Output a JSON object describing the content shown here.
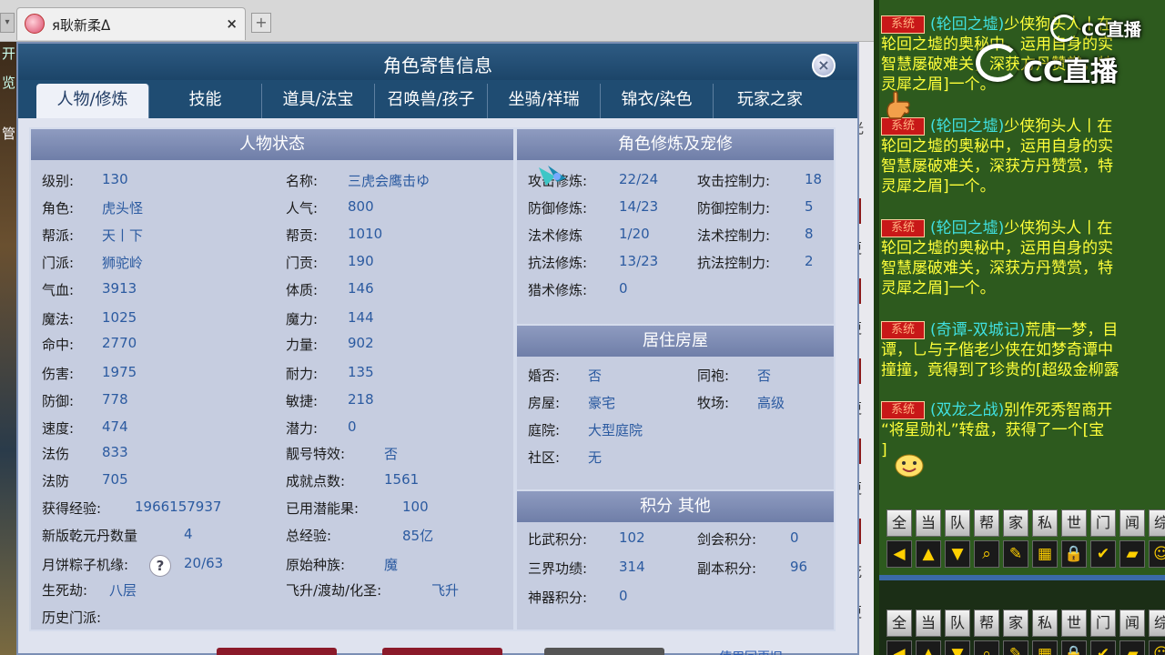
{
  "browser": {
    "tab_title": "я耿新柔ᐃ",
    "close": "×",
    "new_tab": "+",
    "arrow": "▾"
  },
  "dialog": {
    "title": "角色寄售信息",
    "close": "×",
    "tabs": [
      "人物/修炼",
      "技能",
      "道具/法宝",
      "召唤兽/孩子",
      "坐骑/祥瑞",
      "锦衣/染色",
      "玩家之家"
    ]
  },
  "character_status": {
    "header": "人物状态",
    "left": [
      {
        "label": "级别:",
        "value": "130"
      },
      {
        "label": "角色:",
        "value": "虎头怪"
      },
      {
        "label": "帮派:",
        "value": "天丨下"
      },
      {
        "label": "门派:",
        "value": "狮驼岭"
      },
      {
        "label": "气血:",
        "value": "3913"
      },
      {
        "label": "魔法:",
        "value": "1025"
      },
      {
        "label": "命中:",
        "value": "2770"
      },
      {
        "label": "伤害:",
        "value": "1975"
      },
      {
        "label": "防御:",
        "value": "778"
      },
      {
        "label": "速度:",
        "value": "474"
      },
      {
        "label": "法伤",
        "value": "833"
      },
      {
        "label": "法防",
        "value": "705"
      },
      {
        "label": "获得经验:",
        "value": "1966157937"
      },
      {
        "label": "新版乾元丹数量",
        "value": "4"
      },
      {
        "label": "月饼粽子机缘:",
        "value": "20/63"
      },
      {
        "label": "生死劫:",
        "value": "八层"
      },
      {
        "label": "历史门派:",
        "value": ""
      }
    ],
    "right": [
      {
        "label": "名称:",
        "value": "三虎会鹰击ゆ"
      },
      {
        "label": "人气:",
        "value": "800"
      },
      {
        "label": "帮贡:",
        "value": "1010"
      },
      {
        "label": "门贡:",
        "value": "190"
      },
      {
        "label": "体质:",
        "value": "146"
      },
      {
        "label": "魔力:",
        "value": "144"
      },
      {
        "label": "力量:",
        "value": "902"
      },
      {
        "label": "耐力:",
        "value": "135"
      },
      {
        "label": "敏捷:",
        "value": "218"
      },
      {
        "label": "潜力:",
        "value": "0"
      },
      {
        "label": "靓号特效:",
        "value": "否"
      },
      {
        "label": "成就点数:",
        "value": "1561"
      },
      {
        "label": "已用潜能果:",
        "value": "100"
      },
      {
        "label": "总经验:",
        "value": "85亿"
      },
      {
        "label": "原始种族:",
        "value": "魔"
      },
      {
        "label": "飞升/渡劫/化圣:",
        "value": "飞升"
      }
    ],
    "help": "?"
  },
  "cultivation": {
    "header": "角色修炼及宠修",
    "rows": [
      {
        "l1": "攻击修炼:",
        "v1": "22/24",
        "l2": "攻击控制力:",
        "v2": "18"
      },
      {
        "l1": "防御修炼:",
        "v1": "14/23",
        "l2": "防御控制力:",
        "v2": "5"
      },
      {
        "l1": "法术修炼",
        "v1": "1/20",
        "l2": "法术控制力:",
        "v2": "8"
      },
      {
        "l1": "抗法修炼:",
        "v1": "13/23",
        "l2": "抗法控制力:",
        "v2": "2"
      },
      {
        "l1": "猎术修炼:",
        "v1": "0",
        "l2": "",
        "v2": ""
      }
    ]
  },
  "housing": {
    "header": "居住房屋",
    "rows": [
      {
        "l1": "婚否:",
        "v1": "否",
        "l2": "同袍:",
        "v2": "否"
      },
      {
        "l1": "房屋:",
        "v1": "豪宅",
        "l2": "牧场:",
        "v2": "高级"
      },
      {
        "l1": "庭院:",
        "v1": "大型庭院",
        "l2": "",
        "v2": ""
      },
      {
        "l1": "社区:",
        "v1": "无",
        "l2": "",
        "v2": ""
      }
    ]
  },
  "points": {
    "header": "积分 其他",
    "rows": [
      {
        "l1": "比武积分:",
        "v1": "102",
        "l2": "剑会积分:",
        "v2": "0"
      },
      {
        "l1": "三界功绩:",
        "v1": "314",
        "l2": "副本积分:",
        "v2": "96"
      },
      {
        "l1": "神器积分:",
        "v1": "0",
        "l2": "",
        "v2": ""
      }
    ]
  },
  "bottom": {
    "link": "使用回更旧"
  },
  "right_strip": {
    "items": [
      "开",
      "览",
      "管",
      "光"
    ],
    "red_items": [
      "则",
      "则",
      "则",
      "则",
      "则",
      "则"
    ],
    "gray_items": [
      "更",
      "更",
      "更",
      "更",
      "更",
      "更",
      "更",
      "死",
      "更"
    ]
  },
  "chat": {
    "messages": [
      {
        "tag": "系统",
        "chan": "(轮回之墟)",
        "lines": [
          "少侠狗头人丨在",
          "轮回之墟的奥秘中，运用自身的实",
          "智慧屡破难关，深获方丹赞赏，特",
          "灵犀之眉]一个。"
        ]
      },
      {
        "tag": "系统",
        "chan": "(轮回之墟)",
        "lines": [
          "少侠狗头人丨在",
          "轮回之墟的奥秘中，运用自身的实",
          "智慧屡破难关，深获方丹赞赏，特",
          "灵犀之眉]一个。"
        ]
      },
      {
        "tag": "系统",
        "chan": "(轮回之墟)",
        "lines": [
          "少侠狗头人丨在",
          "轮回之墟的奥秘中，运用自身的实",
          "智慧屡破难关，深获方丹赞赏，特",
          "灵犀之眉]一个。"
        ]
      },
      {
        "tag": "系统",
        "chan": "(奇谭-双城记)",
        "lines": [
          "荒唐一梦，目",
          "谭，乚与子偕老少侠在如梦奇谭中",
          "撞撞，竟得到了珍贵的[超级金柳露"
        ]
      },
      {
        "tag": "系统",
        "chan": "(双龙之战)",
        "lines": [
          "别作死秀智商开",
          "“将星勋礼”转盘，获得了一个[宝",
          "]"
        ]
      }
    ],
    "logo": "CC直播",
    "channel_buttons": [
      "全",
      "当",
      "队",
      "帮",
      "家",
      "私",
      "世",
      "门",
      "闻",
      "综"
    ],
    "icon_buttons": [
      "◀",
      "▲",
      "▼",
      "⌕",
      "✎",
      "▦",
      "🔒",
      "✔",
      "▰",
      "☺"
    ]
  },
  "colors": {
    "title_bar": "#1f4c72",
    "panel_head": "#7f8db4",
    "value_blue": "#2b5aa0",
    "chat_bg": "#2d5a1e",
    "chat_yellow": "#ffff3a",
    "system_red": "#c81818"
  }
}
